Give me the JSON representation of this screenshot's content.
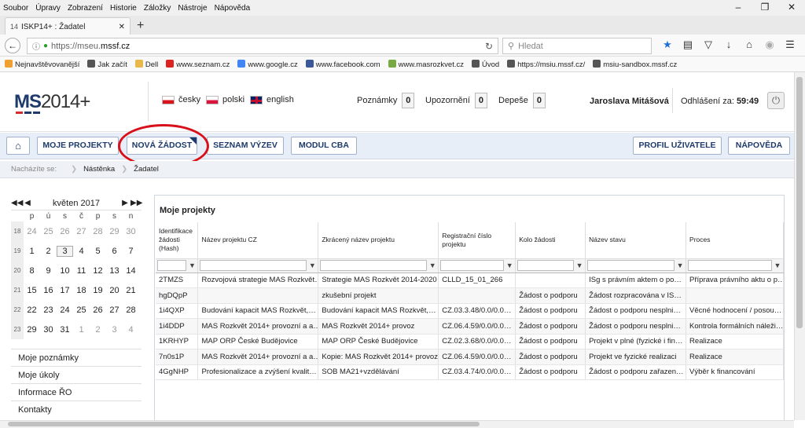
{
  "browser": {
    "menu": [
      "Soubor",
      "Úpravy",
      "Zobrazení",
      "Historie",
      "Záložky",
      "Nástroje",
      "Nápověda"
    ],
    "tab_title": "ISKP14+ : Žadatel",
    "url_prefix": "https://mseu.",
    "url_domain": "mssf.cz",
    "search_placeholder": "Hledat",
    "bookmarks": [
      "Nejnavštěvovanější",
      "Jak začít",
      "Dell",
      "www.seznam.cz",
      "www.google.cz",
      "www.facebook.com",
      "www.masrozkvet.cz",
      "Úvod",
      "https://msiu.mssf.cz/",
      "msiu-sandbox.mssf.cz"
    ]
  },
  "header": {
    "logo_ms": "MS",
    "logo_year": "2014+",
    "langs": [
      "česky",
      "polski",
      "english"
    ],
    "counters": [
      {
        "label": "Poznámky",
        "value": "0"
      },
      {
        "label": "Upozornění",
        "value": "0"
      },
      {
        "label": "Depeše",
        "value": "0"
      }
    ],
    "user": "Jaroslava Mitášová",
    "logout_label": "Odhlášení za:",
    "logout_time": "59:49"
  },
  "nav": {
    "moje_projekty": "MOJE PROJEKTY",
    "nova_zadost": "NOVÁ ŽÁDOST",
    "seznam_vyzev": "SEZNAM VÝZEV",
    "modul_cba": "MODUL CBA",
    "profil": "PROFIL UŽIVATELE",
    "napoveda": "NÁPOVĚDA"
  },
  "breadcrumb": {
    "label": "Nacházíte se:",
    "items": [
      "Nástěnka",
      "Žadatel"
    ]
  },
  "calendar": {
    "month": "květen 2017",
    "dow": [
      "p",
      "ú",
      "s",
      "č",
      "p",
      "s",
      "n"
    ],
    "weeks": [
      {
        "wk": "18",
        "days": [
          "24",
          "25",
          "26",
          "27",
          "28",
          "29",
          "30"
        ]
      },
      {
        "wk": "19",
        "days": [
          "1",
          "2",
          "3",
          "4",
          "5",
          "6",
          "7"
        ]
      },
      {
        "wk": "20",
        "days": [
          "8",
          "9",
          "10",
          "11",
          "12",
          "13",
          "14"
        ]
      },
      {
        "wk": "21",
        "days": [
          "15",
          "16",
          "17",
          "18",
          "19",
          "20",
          "21"
        ]
      },
      {
        "wk": "22",
        "days": [
          "22",
          "23",
          "24",
          "25",
          "26",
          "27",
          "28"
        ]
      },
      {
        "wk": "23",
        "days": [
          "29",
          "30",
          "31",
          "1",
          "2",
          "3",
          "4"
        ]
      }
    ]
  },
  "side_menu": [
    "Moje poznámky",
    "Moje úkoly",
    "Informace ŘO",
    "Kontakty"
  ],
  "projects": {
    "title": "Moje projekty",
    "columns": [
      "Identifikace žádosti (Hash)",
      "Název projektu CZ",
      "Zkrácený název projektu",
      "Registrační číslo projektu",
      "Kolo žádosti",
      "Název stavu",
      "Proces"
    ],
    "rows": [
      [
        "2TMZS",
        "Rozvojová strategie MAS Rozkvět…",
        "Strategie MAS Rozkvět 2014-2020",
        "CLLD_15_01_266",
        "",
        "ISg s právním aktem o po…",
        "Příprava právního aktu o p…"
      ],
      [
        "hgDQpP",
        "",
        "zkušební projekt",
        "",
        "Žádost o podporu",
        "Žádost rozpracována v IS…",
        ""
      ],
      [
        "1i4QXP",
        "Budování kapacit MAS Rozkvět,…",
        "Budování kapacit MAS Rozkvět,…",
        "CZ.03.3.48/0.0/0.0…",
        "Žádost o podporu",
        "Žádost o podporu nesplni…",
        "Věcné hodnocení / posou…"
      ],
      [
        "1i4DDP",
        "MAS Rozkvět 2014+ provozní a a…",
        "MAS Rozkvět 2014+ provoz",
        "CZ.06.4.59/0.0/0.0…",
        "Žádost o podporu",
        "Žádost o podporu nesplni…",
        "Kontrola formálních náleži…"
      ],
      [
        "1KRHYP",
        "MAP ORP České Budějovice",
        "MAP ORP České Budějovice",
        "CZ.02.3.68/0.0/0.0…",
        "Žádost o podporu",
        "Projekt v plné (fyzické i fin…",
        "Realizace"
      ],
      [
        "7n0s1P",
        "MAS Rozkvět 2014+ provozní a a…",
        "Kopie: MAS Rozkvět 2014+ provoz",
        "CZ.06.4.59/0.0/0.0…",
        "Žádost o podporu",
        "Projekt ve fyzické realizaci",
        "Realizace"
      ],
      [
        "4GgNHP",
        "Profesionalizace a zvýšení kvalit…",
        "SOB MA21+vzdělávání",
        "CZ.03.4.74/0.0/0.0…",
        "Žádost o podporu",
        "Žádost o podporu zařazen…",
        "Výběr k financování"
      ]
    ]
  }
}
